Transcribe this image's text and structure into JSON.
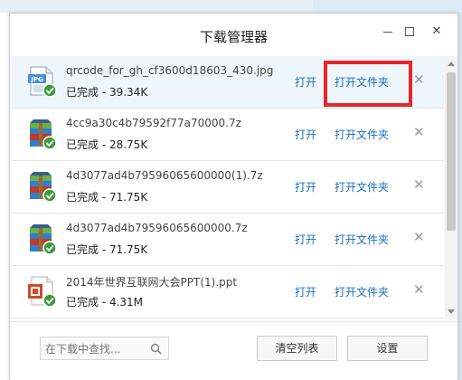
{
  "window": {
    "title": "下载管理器"
  },
  "window_controls": {
    "minimize": "—",
    "maximize": "□",
    "close": "✕"
  },
  "downloads": [
    {
      "name": "qrcode_for_gh_cf3600d18603_430.jpg",
      "status": "已完成 - 39.34K",
      "type": "jpg",
      "open_label": "打开",
      "folder_label": "打开文件夹",
      "delete": "✕"
    },
    {
      "name": "4cc9a30c4b79592f77a70000.7z",
      "status": "已完成 - 28.75K",
      "type": "7z",
      "open_label": "打开",
      "folder_label": "打开文件夹",
      "delete": "✕"
    },
    {
      "name": "4d3077ad4b79596065600000(1).7z",
      "status": "已完成 - 71.75K",
      "type": "7z",
      "open_label": "打开",
      "folder_label": "打开文件夹",
      "delete": "✕"
    },
    {
      "name": "4d3077ad4b79596065600000.7z",
      "status": "已完成 - 71.75K",
      "type": "7z",
      "open_label": "打开",
      "folder_label": "打开文件夹",
      "delete": "✕"
    },
    {
      "name": "2014年世界互联网大会PPT(1).ppt",
      "status": "已完成 - 4.31M",
      "type": "ppt",
      "open_label": "打开",
      "folder_label": "打开文件夹",
      "delete": "✕"
    }
  ],
  "file_icon_badge": "JPG",
  "footer": {
    "search_placeholder": "在下载中查找...",
    "clear_label": "清空列表",
    "settings_label": "设置"
  },
  "colors": {
    "link": "#1a6fc2",
    "highlight": "#e8242c",
    "check": "#3a9a3a"
  }
}
